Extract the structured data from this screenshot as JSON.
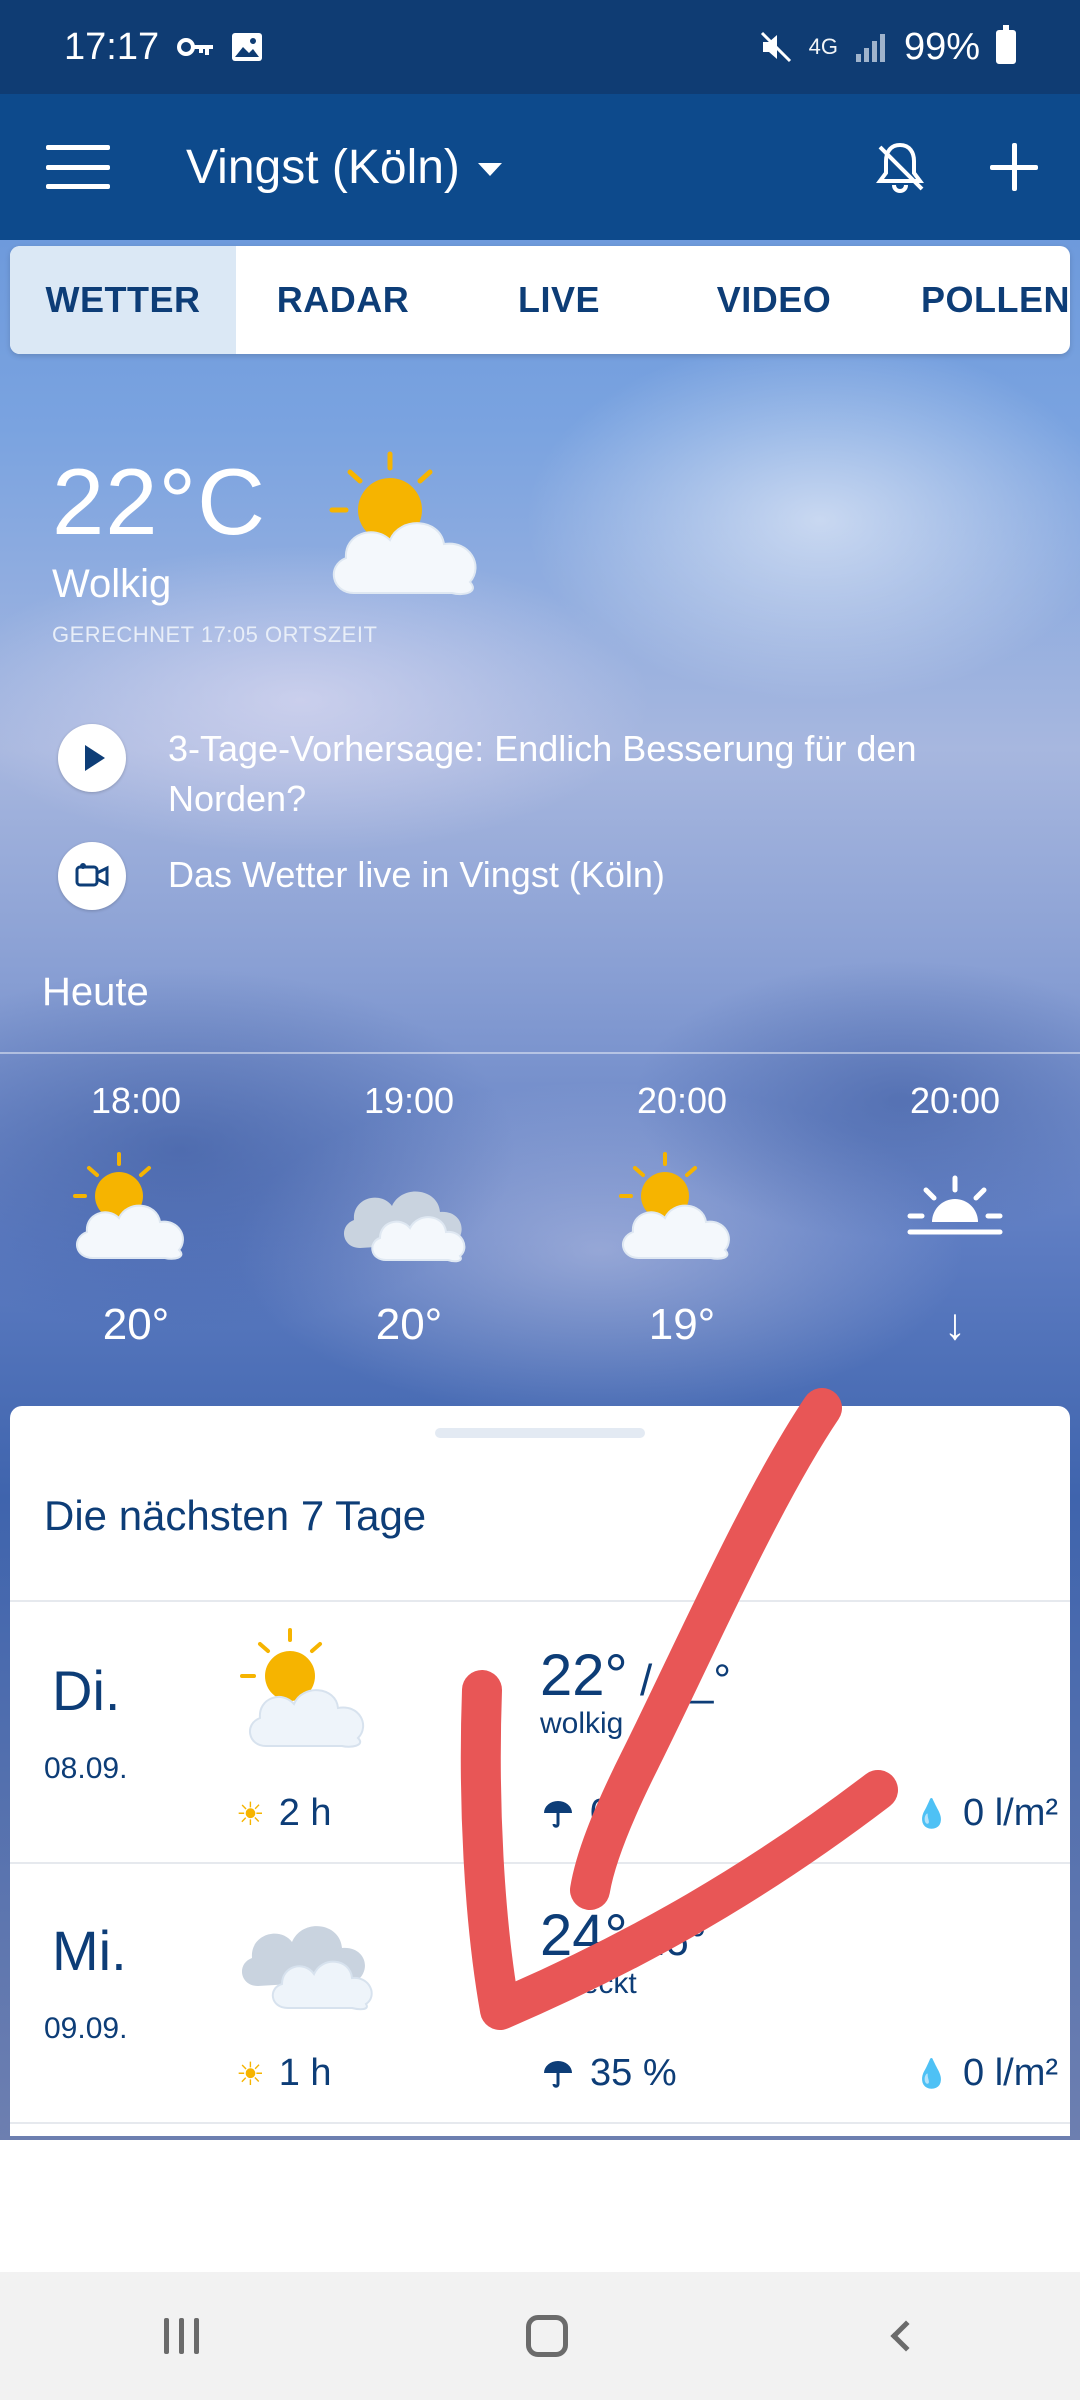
{
  "status_bar": {
    "time": "17:17",
    "network": "4G",
    "battery": "99%"
  },
  "app_bar": {
    "location": "Vingst (Köln)"
  },
  "tabs": [
    {
      "label": "WETTER",
      "active": true
    },
    {
      "label": "RADAR",
      "active": false
    },
    {
      "label": "LIVE",
      "active": false
    },
    {
      "label": "VIDEO",
      "active": false
    },
    {
      "label": "POLLEN",
      "active": false
    }
  ],
  "current": {
    "temperature": "22°C",
    "condition": "Wolkig",
    "calculated": "GERECHNET 17:05 ORTSZEIT",
    "icon": "sun-cloud-icon"
  },
  "news": [
    {
      "text": "3-Tage-Vorhersage: Endlich Besserung für den Norden?",
      "icon": "play-icon"
    },
    {
      "text": "Das Wetter live in Vingst (Köln)",
      "icon": "video-camera-icon"
    }
  ],
  "today": {
    "label": "Heute",
    "hours": [
      {
        "time": "18:00",
        "icon": "sun-cloud-icon",
        "temp": "20°"
      },
      {
        "time": "19:00",
        "icon": "cloud-icon",
        "temp": "20°"
      },
      {
        "time": "20:00",
        "icon": "sun-cloud-icon",
        "temp": "19°"
      },
      {
        "time": "20:00",
        "icon": "sunset-icon",
        "temp": "↓"
      }
    ]
  },
  "forecast": {
    "title": "Die nächsten 7 Tage",
    "days": [
      {
        "day": "Di.",
        "date": "08.09.",
        "icon": "sun-cloud-icon",
        "sun": "2 h",
        "hi": "22°",
        "sep": " / ",
        "lo": "1_°",
        "condition": "wolkig",
        "rain": "0",
        "amount": "0 l/m²"
      },
      {
        "day": "Mi.",
        "date": "09.09.",
        "icon": "cloud-icon",
        "sun": "1 h",
        "hi": "24°",
        "sep": " ",
        "lo": "16°",
        "condition": "...deckt",
        "rain": "35 %",
        "amount": "0 l/m²"
      }
    ]
  },
  "colors": {
    "primary": "#0d4a8c",
    "status_bar": "#0f3c73",
    "text_dark": "#0d3d77",
    "annotation": "#e85656"
  }
}
